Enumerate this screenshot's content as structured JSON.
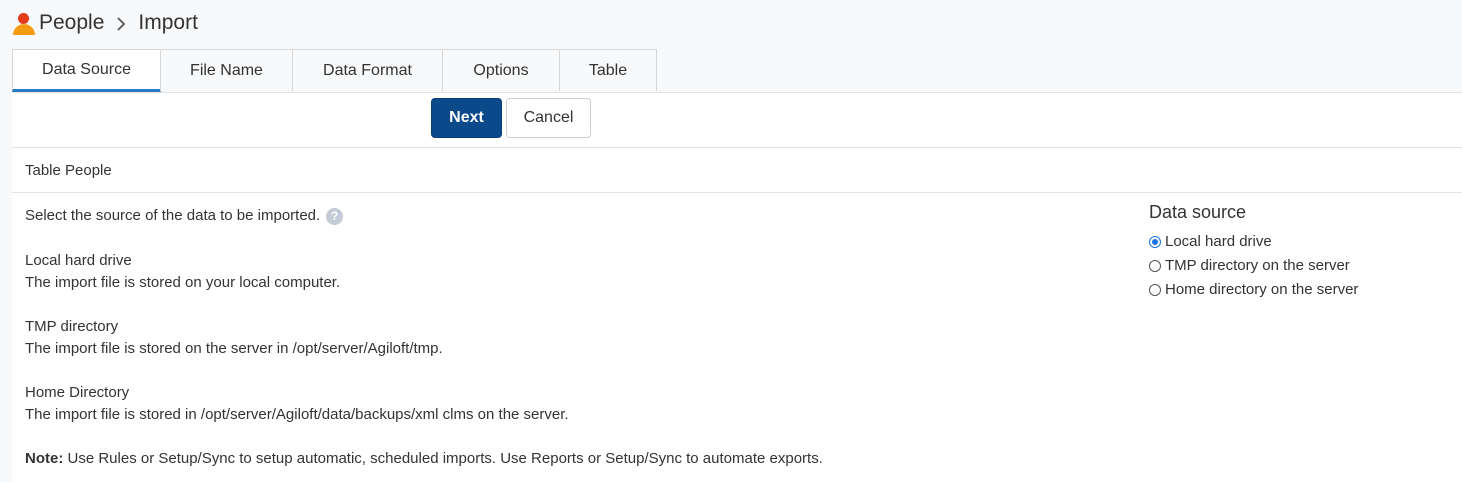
{
  "breadcrumb": {
    "root": "People",
    "current": "Import"
  },
  "tabs": [
    "Data Source",
    "File Name",
    "Data Format",
    "Options",
    "Table"
  ],
  "active_tab": "Data Source",
  "buttons": {
    "next": "Next",
    "cancel": "Cancel"
  },
  "table_label": "Table People",
  "intro": "Select the source of the data to be imported.",
  "help_icon": "?",
  "descriptions": [
    {
      "title": "Local hard drive",
      "text": "The import file is stored on your local computer."
    },
    {
      "title": "TMP directory",
      "text": "The import file is stored on the server in /opt/server/Agiloft/tmp."
    },
    {
      "title": "Home Directory",
      "text": "The import file is stored in /opt/server/Agiloft/data/backups/xml clms on the server."
    }
  ],
  "note": {
    "label": "Note:",
    "text": " Use Rules or Setup/Sync to setup automatic, scheduled imports. Use Reports or Setup/Sync to automate exports."
  },
  "data_source": {
    "title": "Data source",
    "options": [
      "Local hard drive",
      "TMP directory on the server",
      "Home directory on the server"
    ],
    "selected": "Local hard drive"
  },
  "colors": {
    "accent": "#0a4a8a",
    "tab_underline": "#2a7cc7",
    "radio": "#1a73e8"
  }
}
